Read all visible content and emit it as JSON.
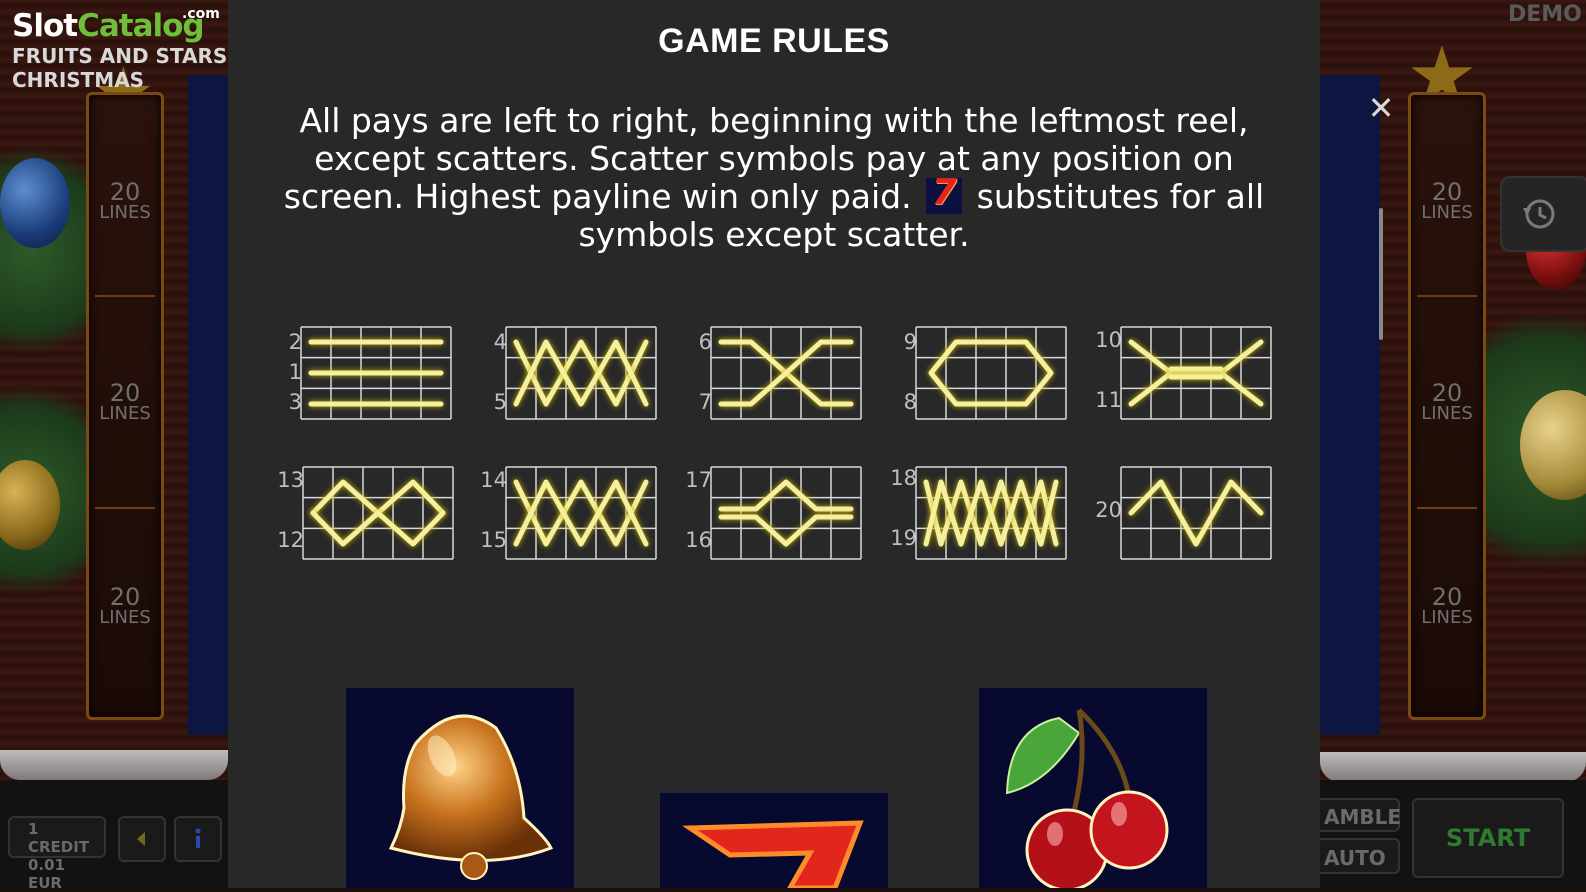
{
  "logo": {
    "brand_first": "Slot",
    "brand_second": "Catalog",
    "brand_suffix": ".com",
    "game_title_line1": "FRUITS AND STARS",
    "game_title_line2": "CHRISTMAS"
  },
  "background": {
    "demo_label": "DEMO",
    "lines_number": "20",
    "lines_word": "LINES",
    "credit_label": "1 CREDIT",
    "credit_value": "0.01 EUR",
    "gamble_label": "AMBLE",
    "auto_label": "AUTO",
    "start_label": "START",
    "sound_icon": "speaker-icon",
    "info_icon": "info-icon",
    "history_icon": "history-icon"
  },
  "modal": {
    "title": "GAME RULES",
    "rules_part1": "All pays are left to right, beginning with the leftmost reel, except scatters. Scatter symbols pay at any position on screen. Highest payline win only paid.",
    "rules_wild_symbol": "7",
    "rules_part2": "substitutes for all symbols except scatter.",
    "close_icon": "close-icon"
  },
  "paylines": [
    {
      "labels": [
        "2",
        "1",
        "3"
      ]
    },
    {
      "labels": [
        "4",
        "5"
      ]
    },
    {
      "labels": [
        "6",
        "7"
      ]
    },
    {
      "labels": [
        "9",
        "8"
      ]
    },
    {
      "labels": [
        "10",
        "11"
      ]
    },
    {
      "labels": [
        "13",
        "12"
      ]
    },
    {
      "labels": [
        "14",
        "15"
      ]
    },
    {
      "labels": [
        "17",
        "16"
      ]
    },
    {
      "labels": [
        "18",
        "19"
      ]
    },
    {
      "labels": [
        "20"
      ]
    }
  ],
  "symbols": [
    "bell-symbol",
    "seven-symbol",
    "cherry-symbol"
  ],
  "colors": {
    "modal_bg": "#282828",
    "payline_glow": "#f5f0a0",
    "logo_green": "#6fbf3a",
    "symbol_bg": "#07092e"
  }
}
